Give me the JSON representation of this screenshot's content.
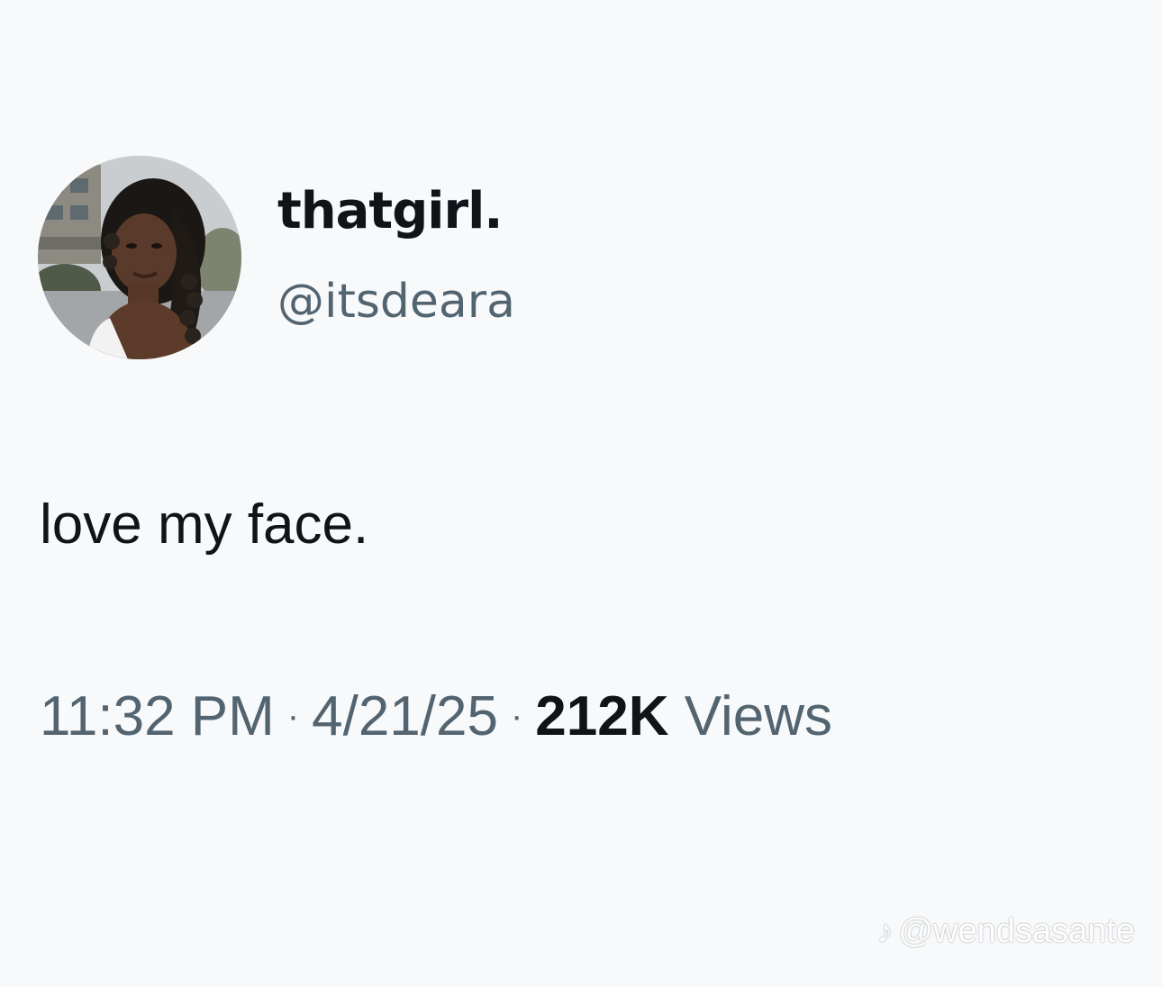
{
  "tweet": {
    "author": {
      "display_name": "thatgirl.",
      "handle": "@itsdeara",
      "avatar_icon": "profile-photo"
    },
    "text": "love my face.",
    "time": "11:32 PM",
    "separator": "·",
    "date": "4/21/25",
    "views_count": "212K",
    "views_label": "Views"
  },
  "watermark": {
    "icon": "tiktok-icon",
    "text": "@wendsasante"
  },
  "colors": {
    "background": "#f8f9fa",
    "primary_text": "#0f1419",
    "secondary_text": "#536471"
  }
}
